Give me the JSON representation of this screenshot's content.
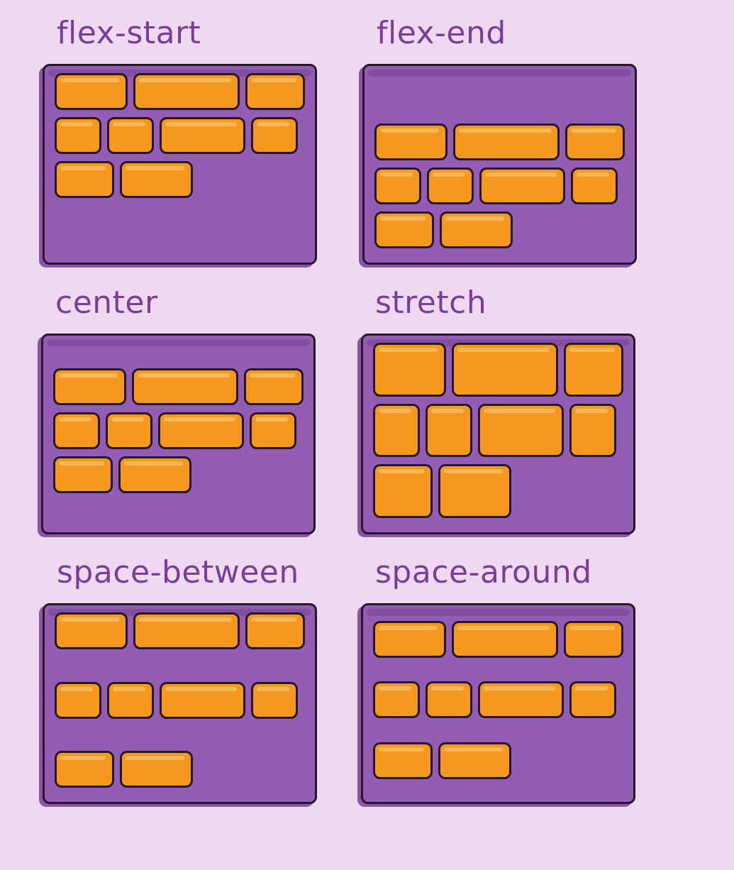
{
  "panels": [
    {
      "title": "flex-start"
    },
    {
      "title": "flex-end"
    },
    {
      "title": "center"
    },
    {
      "title": "stretch"
    },
    {
      "title": "space-between"
    },
    {
      "title": "space-around"
    }
  ],
  "colors": {
    "background": "#eed9f1",
    "container": "#955cb4",
    "item": "#f6981e",
    "outline": "#24192b",
    "label": "#7a3d9a"
  }
}
